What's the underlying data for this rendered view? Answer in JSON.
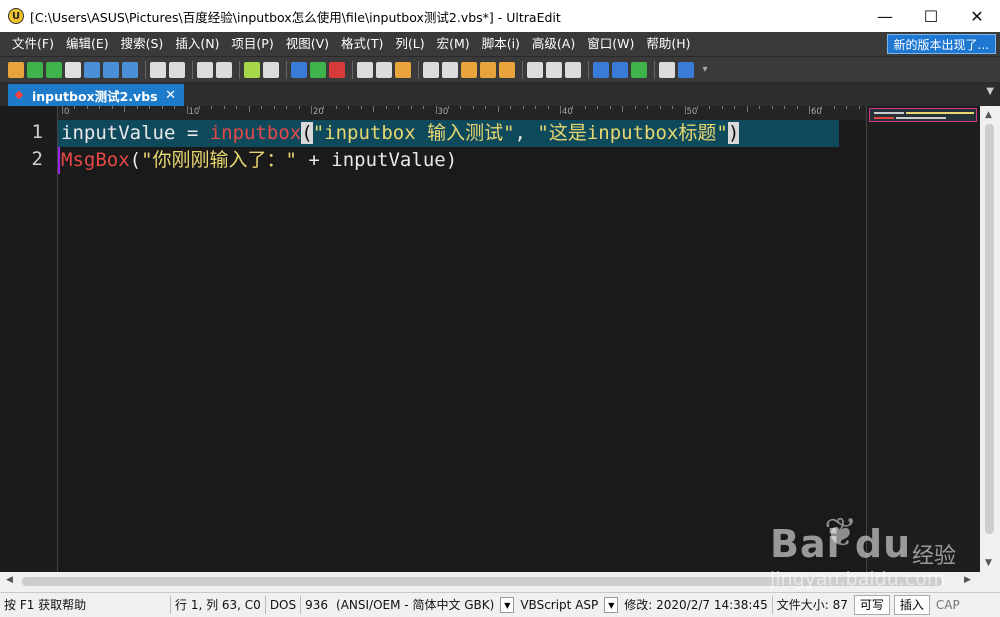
{
  "window": {
    "title": "[C:\\Users\\ASUS\\Pictures\\百度经验\\inputbox怎么使用\\file\\inputbox测试2.vbs*] - UltraEdit",
    "icon": "ultraedit-icon",
    "controls": {
      "minimize": "—",
      "maximize": "☐",
      "close": "✕"
    }
  },
  "menu": {
    "items": [
      "文件(F)",
      "编辑(E)",
      "搜索(S)",
      "插入(N)",
      "项目(P)",
      "视图(V)",
      "格式(T)",
      "列(L)",
      "宏(M)",
      "脚本(i)",
      "高级(A)",
      "窗口(W)",
      "帮助(H)"
    ],
    "new_version": "新的版本出现了..."
  },
  "toolbar": {
    "buttons": [
      {
        "icon": "new-file-icon",
        "color": "#e8a33d"
      },
      {
        "icon": "back-icon",
        "color": "#3db34a"
      },
      {
        "icon": "forward-icon",
        "color": "#3db34a"
      },
      {
        "icon": "open-file-icon",
        "color": "#e0e0e0"
      },
      {
        "icon": "open-folder-icon",
        "color": "#4a8fd8"
      },
      {
        "icon": "recent-folder-icon",
        "color": "#4a8fd8"
      },
      {
        "icon": "save-icon",
        "color": "#4a8fd8"
      },
      {
        "sep": true
      },
      {
        "icon": "print-icon",
        "color": "#dcdcdc"
      },
      {
        "icon": "print-preview-icon",
        "color": "#dcdcdc"
      },
      {
        "sep": true
      },
      {
        "icon": "list-icon",
        "color": "#dcdcdc"
      },
      {
        "icon": "bookmark-icon",
        "color": "#dcdcdc"
      },
      {
        "sep": true
      },
      {
        "icon": "column-icon",
        "color": "#a8d84a"
      },
      {
        "icon": "page-icon",
        "color": "#dcdcdc"
      },
      {
        "sep": true
      },
      {
        "icon": "macro-play-icon",
        "color": "#3a7bd8"
      },
      {
        "icon": "macro-record-icon",
        "color": "#3db34a"
      },
      {
        "icon": "macro-stop-icon",
        "color": "#d83a3a"
      },
      {
        "sep": true
      },
      {
        "icon": "cut-icon",
        "color": "#dcdcdc"
      },
      {
        "icon": "copy-icon",
        "color": "#dcdcdc"
      },
      {
        "icon": "paste-icon",
        "color": "#e8a33d"
      },
      {
        "sep": true
      },
      {
        "icon": "find-icon",
        "color": "#dcdcdc"
      },
      {
        "icon": "find-next-icon",
        "color": "#dcdcdc"
      },
      {
        "icon": "replace-icon",
        "color": "#e8a33d"
      },
      {
        "icon": "find-files-icon",
        "color": "#e8a33d"
      },
      {
        "icon": "replace-files-icon",
        "color": "#e8a33d"
      },
      {
        "sep": true
      },
      {
        "icon": "window-tile-icon",
        "color": "#dcdcdc"
      },
      {
        "icon": "window-split-icon",
        "color": "#dcdcdc"
      },
      {
        "icon": "window-cascade-icon",
        "color": "#dcdcdc"
      },
      {
        "sep": true
      },
      {
        "icon": "browser-icon",
        "color": "#3a7bd8"
      },
      {
        "icon": "ftp-icon",
        "color": "#3a7bd8"
      },
      {
        "icon": "refresh-icon",
        "color": "#3db34a"
      },
      {
        "sep": true
      },
      {
        "icon": "word-wrap-icon",
        "color": "#dcdcdc"
      },
      {
        "icon": "help-icon",
        "color": "#3a7bd8"
      }
    ]
  },
  "tab": {
    "label": "inputbox测试2.vbs",
    "close": "✕",
    "overflow": "▼"
  },
  "ruler": {
    "labels": [
      "0",
      "10",
      "20",
      "30",
      "40",
      "50",
      "60"
    ]
  },
  "editor": {
    "line_numbers": [
      "1",
      "2"
    ],
    "line1": {
      "var": "inputValue",
      "op": " = ",
      "func": "inputbox",
      "lparen": "(",
      "str1": "\"inputbox 输入测试\"",
      "comma": ", ",
      "str2": "\"这是inputbox标题\"",
      "rparen": ")"
    },
    "line2": {
      "func": "MsgBox",
      "lparen": "(",
      "str1": "\"你刚刚输入了：\"",
      "rest": " + inputValue)"
    },
    "colors": {
      "background": "#1a1a1a",
      "active_line": "#0f4a5c",
      "function": "#e64848",
      "string": "#e8d670",
      "text": "#e8e8e8"
    }
  },
  "statusbar": {
    "help": "按 F1 获取帮助",
    "position": "行 1, 列 63, C0",
    "line_ending": "DOS",
    "codepage": "936",
    "encoding": "(ANSI/OEM - 简体中文 GBK)",
    "language": "VBScript ASP",
    "modified": "修改:   2020/2/7 14:38:45",
    "filesize": "文件大小:   87",
    "writable": "可写",
    "insert": "插入",
    "cap": "CAP"
  },
  "watermark": {
    "brand": "Bai du",
    "cn": "经验",
    "url": "jingyan.baidu.com"
  }
}
